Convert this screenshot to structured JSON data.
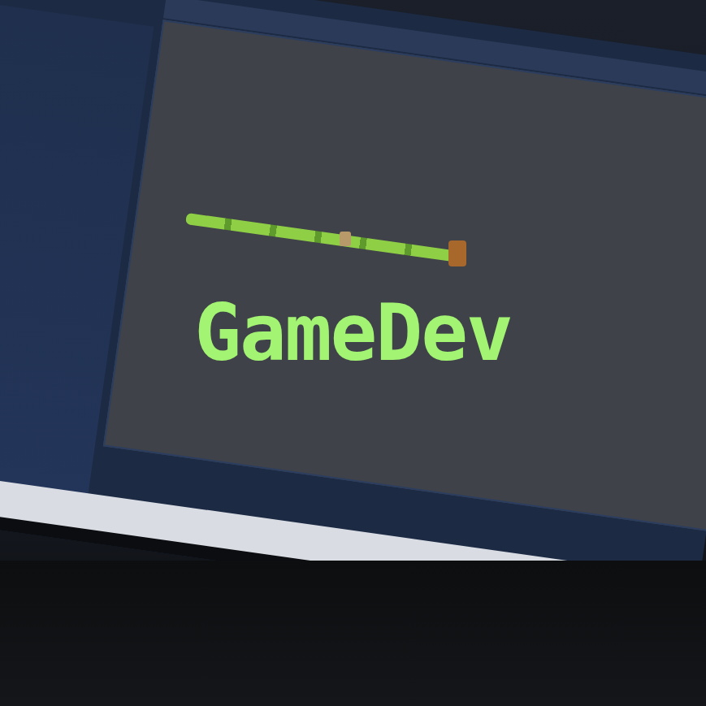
{
  "title": "GameDev"
}
